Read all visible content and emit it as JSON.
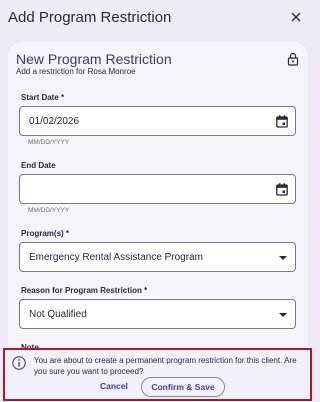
{
  "dialog": {
    "title": "Add Program Restriction"
  },
  "card": {
    "title": "New Program Restriction",
    "subtitle": "Add a restriction for Rosa Monroe"
  },
  "form": {
    "start_date": {
      "label": "Start Date *",
      "value": "01/02/2026",
      "hint": "MM/DD/YYYY"
    },
    "end_date": {
      "label": "End Date",
      "value": "",
      "hint": "MM/DD/YYYY"
    },
    "programs": {
      "label": "Program(s) *",
      "value": "Emergency Rental Assistance Program"
    },
    "reason": {
      "label": "Reason for Program Restriction *",
      "value": "Not Qualified"
    },
    "note": {
      "label": "Note"
    }
  },
  "confirm": {
    "message": "You are about to create a permanent program restriction for this client. Are you sure you want to proceed?",
    "cancel_label": "Cancel",
    "confirm_label": "Confirm & Save"
  },
  "colors": {
    "accent": "#3e3ea6",
    "alert_border": "#b0192a",
    "background": "#efeaf6"
  }
}
